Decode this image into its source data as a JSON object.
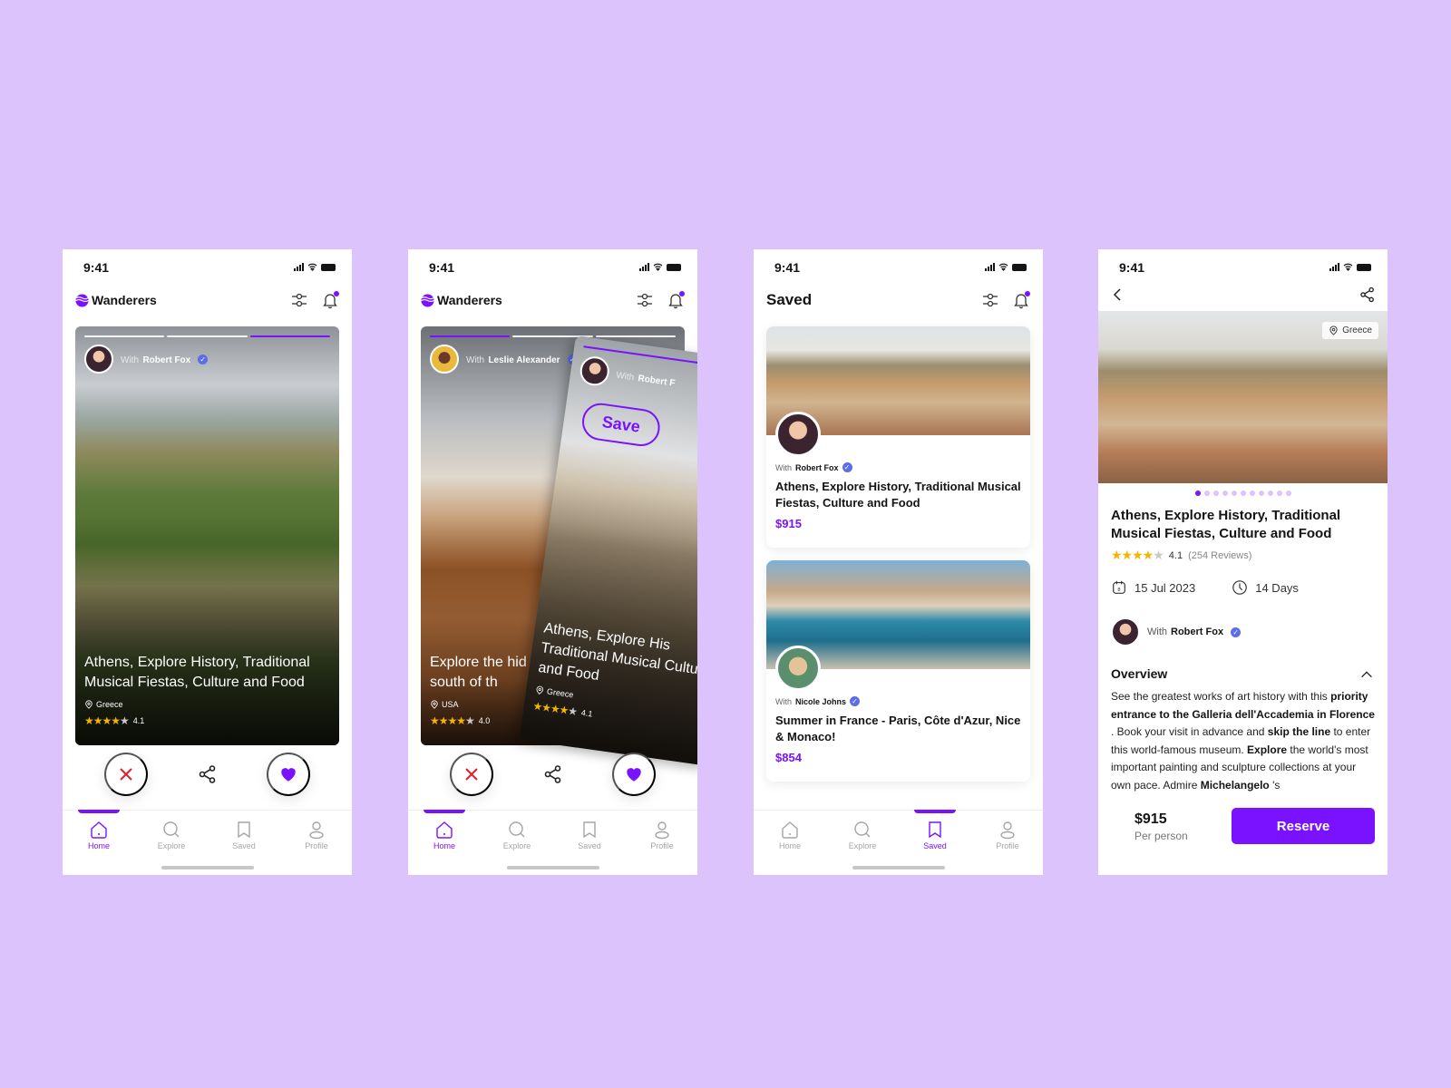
{
  "colors": {
    "accent": "#7a12ff",
    "background": "#dcc3fb",
    "star": "#f6b300",
    "dislike": "#e0202f",
    "verified": "#5b6ee8"
  },
  "status_time": "9:41",
  "screens": {
    "home": {
      "brand": "Wanderers",
      "card": {
        "progress_segments": 3,
        "active_segment": 3,
        "with_label": "With",
        "host": "Robert Fox",
        "title": "Athens, Explore History, Traditional Musical Fiestas, Culture and Food",
        "location": "Greece",
        "rating": "4.1",
        "stars_filled": 4
      }
    },
    "swipe": {
      "brand": "Wanderers",
      "back_card": {
        "with_label": "With",
        "host": "Leslie Alexander",
        "title": "Explore the hid the south of th",
        "location": "USA",
        "rating": "4.0",
        "stars_filled": 4
      },
      "front_card": {
        "with_label": "With",
        "host": "Robert F",
        "stamp": "Save",
        "title": "Athens, Explore His Traditional Musical Culture and Food",
        "location": "Greece",
        "rating": "4.1",
        "stars_filled": 4
      }
    },
    "saved": {
      "title": "Saved",
      "items": [
        {
          "with_label": "With",
          "host": "Robert Fox",
          "title": "Athens, Explore History, Traditional Musical Fiestas, Culture and Food",
          "price": "$915"
        },
        {
          "with_label": "With",
          "host": "Nicole Johns",
          "title": "Summer in France - Paris, Côte d'Azur, Nice & Monaco!",
          "price": "$854"
        }
      ]
    },
    "detail": {
      "location": "Greece",
      "gallery_count": 11,
      "gallery_index": 1,
      "title": "Athens, Explore History, Traditional Musical Fiestas, Culture and Food",
      "rating": "4.1",
      "stars_filled": 4,
      "reviews": "(254 Reviews)",
      "date": "15 Jul 2023",
      "duration": "14 Days",
      "with_label": "With",
      "host": "Robert Fox",
      "overview_heading": "Overview",
      "overview": [
        {
          "t": "See the greatest works of art history with this ",
          "b": false
        },
        {
          "t": "priority entrance to the Galleria dell'Accademia in Florence",
          "b": true
        },
        {
          "t": " . Book your visit in advance and ",
          "b": false
        },
        {
          "t": "skip the line",
          "b": true
        },
        {
          "t": " to enter this world-famous museum. ",
          "b": false
        },
        {
          "t": "Explore",
          "b": true
        },
        {
          "t": " the world's most important painting and sculpture collections at your own pace. Admire ",
          "b": false
        },
        {
          "t": "Michelangelo",
          "b": true
        },
        {
          "t": " 's",
          "b": false
        }
      ],
      "price": "$915",
      "per_person": "Per person",
      "reserve_label": "Reserve"
    }
  },
  "tabbar": [
    {
      "label": "Home",
      "icon": "home-icon"
    },
    {
      "label": "Explore",
      "icon": "search-icon"
    },
    {
      "label": "Saved",
      "icon": "bookmark-icon"
    },
    {
      "label": "Profile",
      "icon": "profile-icon"
    }
  ]
}
